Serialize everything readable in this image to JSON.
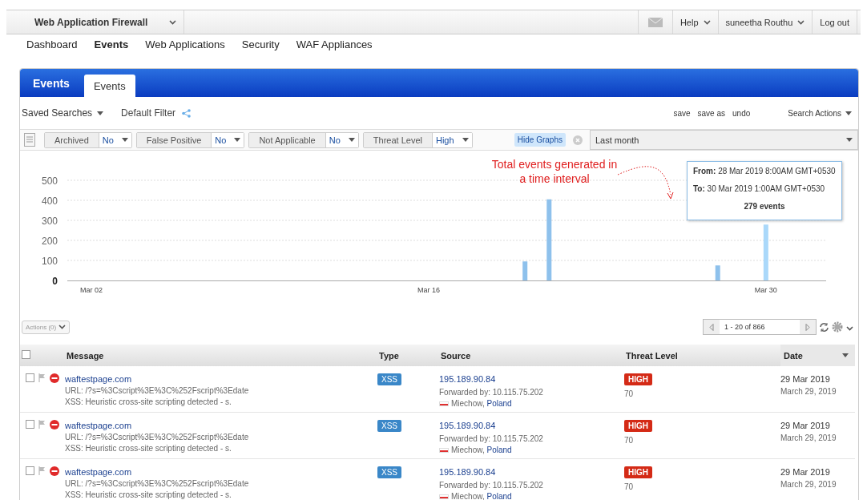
{
  "topbar": {
    "app_menu": "Web Application Firewall",
    "help": "Help",
    "user": "suneetha Routhu",
    "logout": "Log out"
  },
  "nav": [
    {
      "label": "Dashboard",
      "selected": false
    },
    {
      "label": "Events",
      "selected": true
    },
    {
      "label": "Web Applications",
      "selected": false
    },
    {
      "label": "Security",
      "selected": false
    },
    {
      "label": "WAF Appliances",
      "selected": false
    }
  ],
  "panel": {
    "title": "Events",
    "tabs": [
      {
        "label": "Events",
        "selected": true
      }
    ]
  },
  "search_bar": {
    "saved_searches": "Saved Searches",
    "filter_name": "Default Filter",
    "links": [
      "save",
      "save as",
      "undo"
    ],
    "search_actions": "Search Actions"
  },
  "filters": [
    {
      "label": "Archived",
      "value": "No"
    },
    {
      "label": "False Positive",
      "value": "No"
    },
    {
      "label": "Not Applicable",
      "value": "No"
    },
    {
      "label": "Threat Level",
      "value": "High"
    }
  ],
  "hide_graphs": "Hide Graphs",
  "time_range": "Last month",
  "chart": {
    "annotation_line_1": "Total events generated in",
    "annotation_line_2": "a time interval",
    "tooltip": {
      "from_label": "From:",
      "from": "28 Mar 2019 8:00AM GMT+0530",
      "to_label": "To:",
      "to": "30 Mar 2019 1:00AM GMT+0530",
      "count": "279 events"
    },
    "chart_data": {
      "type": "bar",
      "categories": [
        null,
        "Mar 02",
        null,
        null,
        null,
        null,
        null,
        null,
        null,
        null,
        null,
        null,
        null,
        null,
        null,
        "Mar 16",
        null,
        null,
        null,
        null,
        null,
        null,
        null,
        null,
        null,
        null,
        null,
        null,
        null,
        "Mar 30",
        null,
        null
      ],
      "values": [
        null,
        null,
        null,
        null,
        null,
        null,
        null,
        null,
        null,
        null,
        null,
        null,
        null,
        null,
        null,
        null,
        null,
        null,
        null,
        95,
        405,
        null,
        null,
        null,
        null,
        null,
        null,
        75,
        null,
        279,
        null,
        null
      ],
      "ylim": [
        0,
        500
      ],
      "grid": true,
      "yticks": [
        0,
        100,
        200,
        300,
        400,
        500
      ]
    }
  },
  "actions": "Actions (0)",
  "pagination": "1 - 20 of 866",
  "table": {
    "select_all_checked": false,
    "columns": [
      "Message",
      "Type",
      "Source",
      "Threat Level",
      "Date"
    ],
    "rows": [
      {
        "selected": false,
        "message": "waftestpage.com",
        "url": "URL: /?s=%3Cscript%3E%3C%252Fscript%3Edate",
        "detail": "XSS: Heuristic cross-site scripting detected - s.",
        "type": "XSS",
        "ip": "195.189.90.84",
        "forwarded": "Forwarded by: 10.115.75.202",
        "city": "Miechow,",
        "country": "Poland",
        "threat": "HIGH",
        "score": "70",
        "date": "29 Mar 2019",
        "date_long": "March 29, 2019"
      },
      {
        "selected": false,
        "message": "waftestpage.com",
        "url": "URL: /?s=%3Cscript%3E%3C%252Fscript%3Edate",
        "detail": "XSS: Heuristic cross-site scripting detected - s.",
        "type": "XSS",
        "ip": "195.189.90.84",
        "forwarded": "Forwarded by: 10.115.75.202",
        "city": "Miechow,",
        "country": "Poland",
        "threat": "HIGH",
        "score": "70",
        "date": "29 Mar 2019",
        "date_long": "March 29, 2019"
      },
      {
        "selected": false,
        "message": "waftestpage.com",
        "url": "URL: /?s=%3Cscript%3E%3C%252Fscript%3Edate",
        "detail": "XSS: Heuristic cross-site scripting detected - s.",
        "type": "XSS",
        "ip": "195.189.90.84",
        "forwarded": "Forwarded by: 10.115.75.202",
        "city": "Miechow,",
        "country": "Poland",
        "threat": "HIGH",
        "score": "70",
        "date": "29 Mar 2019",
        "date_long": "March 29, 2019"
      }
    ]
  }
}
